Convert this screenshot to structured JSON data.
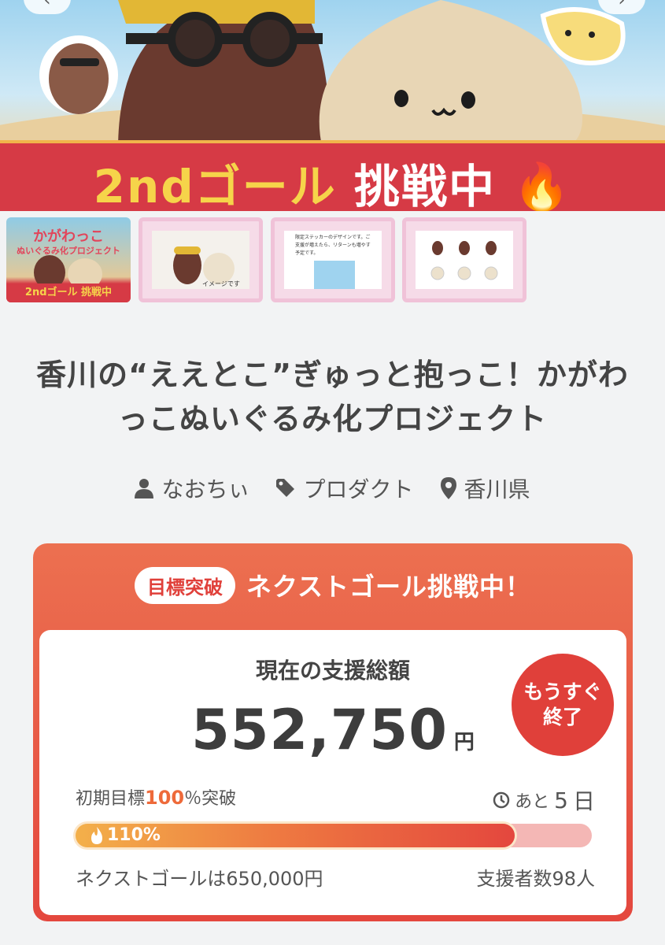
{
  "hero": {
    "banner_text_part1": "2ndゴール",
    "banner_text_part2": "挑戦中"
  },
  "thumbnails": [
    {
      "title": "かがわっこ",
      "subtitle": "ぬいぐるみ化プロジェクト",
      "band": "2ndゴール 挑戦中"
    },
    {
      "caption": "イメージです"
    },
    {
      "caption": "限定ステッカーのデザインです。ご支援が増えたら、リターンも増やす予定です。"
    },
    {
      "caption": ""
    }
  ],
  "project": {
    "title": "香川の“ええとこ”ぎゅっと抱っこ！かがわっこぬいぐるみ化プロジェクト",
    "author": "なおちぃ",
    "category": "プロダクト",
    "location": "香川県"
  },
  "funding": {
    "goal_badge": "目標突破",
    "header_text": "ネクストゴール挑戦中！",
    "total_label": "現在の支援総額",
    "total_amount": "552,750",
    "currency": "円",
    "ending_badge_line1": "もうすぐ",
    "ending_badge_line2": "終了",
    "initial_goal_prefix": "初期目標",
    "initial_goal_pct": "100",
    "initial_goal_suffix": "％突破",
    "remaining_prefix": "あと",
    "remaining_days": "5",
    "remaining_suffix": "日",
    "progress_label": "110%",
    "progress_fraction": 0.85,
    "next_goal_text": "ネクストゴールは650,000円",
    "backers_text": "支援者数98人"
  },
  "colors": {
    "accent_red": "#e0403a",
    "accent_orange": "#ee7a41",
    "banner_red": "#d63a45",
    "banner_yellow": "#f6d44a"
  }
}
